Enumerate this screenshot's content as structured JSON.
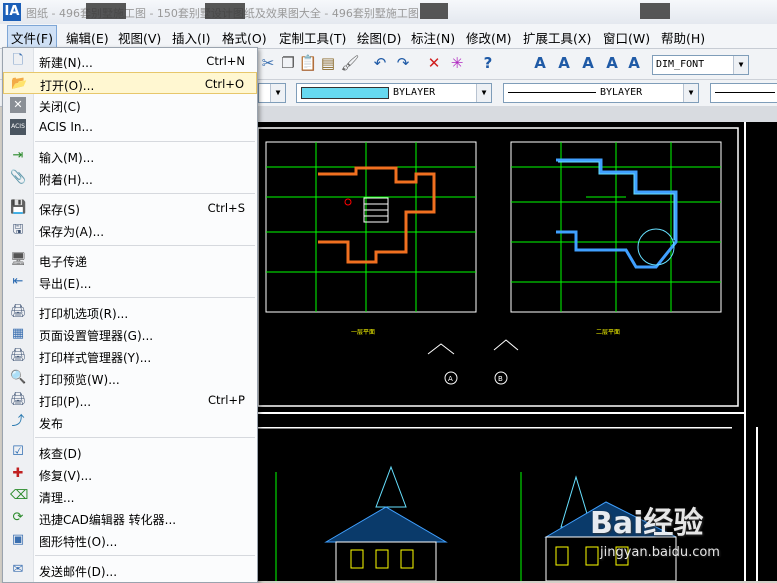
{
  "titlebar": {
    "app_icon": "IA",
    "title": "图纸 - 496套别墅施工图 - 150套别墅设计图纸及效果图大全 - 496套别墅施工图"
  },
  "menubar": {
    "items": [
      {
        "label": "文件(F)"
      },
      {
        "label": "编辑(E)"
      },
      {
        "label": "视图(V)"
      },
      {
        "label": "插入(I)"
      },
      {
        "label": "格式(O)"
      },
      {
        "label": "定制工具(T)"
      },
      {
        "label": "绘图(D)"
      },
      {
        "label": "标注(N)"
      },
      {
        "label": "修改(M)"
      },
      {
        "label": "扩展工具(X)"
      },
      {
        "label": "窗口(W)"
      },
      {
        "label": "帮助(H)"
      }
    ]
  },
  "toolbar": {
    "dim_style": "DIM_FONT",
    "color_layer": "BYLAYER",
    "linetype": "BYLAYER",
    "linecolor": "#66d9f0"
  },
  "file_menu": {
    "items": [
      {
        "label": "新建(N)...",
        "shortcut": "Ctrl+N",
        "icon": "new-file-icon"
      },
      {
        "label": "打开(O)...",
        "shortcut": "Ctrl+O",
        "icon": "open-folder-icon"
      },
      {
        "label": "关闭(C)",
        "shortcut": "",
        "icon": "close-icon"
      },
      {
        "label": "ACIS In...",
        "shortcut": "",
        "icon": "acis-icon"
      },
      {
        "label": "输入(M)...",
        "shortcut": "",
        "icon": "import-icon"
      },
      {
        "label": "附着(H)...",
        "shortcut": "",
        "icon": "attach-icon"
      },
      {
        "label": "保存(S)",
        "shortcut": "Ctrl+S",
        "icon": "save-icon"
      },
      {
        "label": "保存为(A)...",
        "shortcut": "",
        "icon": "save-as-icon"
      },
      {
        "label": "电子传递",
        "shortcut": "",
        "icon": "etransmit-icon"
      },
      {
        "label": "导出(E)...",
        "shortcut": "",
        "icon": "export-icon"
      },
      {
        "label": "打印机选项(R)...",
        "shortcut": "",
        "icon": "printer-options-icon"
      },
      {
        "label": "页面设置管理器(G)...",
        "shortcut": "",
        "icon": "page-setup-icon"
      },
      {
        "label": "打印样式管理器(Y)...",
        "shortcut": "",
        "icon": "plot-style-icon"
      },
      {
        "label": "打印预览(W)...",
        "shortcut": "",
        "icon": "print-preview-icon"
      },
      {
        "label": "打印(P)...",
        "shortcut": "Ctrl+P",
        "icon": "print-icon"
      },
      {
        "label": "发布",
        "shortcut": "",
        "icon": "publish-icon"
      },
      {
        "label": "核查(D)",
        "shortcut": "",
        "icon": "audit-icon"
      },
      {
        "label": "修复(V)...",
        "shortcut": "",
        "icon": "recover-icon"
      },
      {
        "label": "清理...",
        "shortcut": "",
        "icon": "purge-icon"
      },
      {
        "label": "迅捷CAD编辑器 转化器...",
        "shortcut": "",
        "icon": "converter-icon"
      },
      {
        "label": "图形特性(O)...",
        "shortcut": "",
        "icon": "drawing-properties-icon"
      },
      {
        "label": "发送邮件(D)...",
        "shortcut": "",
        "icon": "send-mail-icon"
      }
    ]
  },
  "drawing": {
    "plan_labels": [
      "一层平面",
      "二层平面"
    ],
    "axis_marks": [
      "A",
      "B"
    ]
  },
  "watermark": {
    "brand": "Bai经验",
    "url": "jingyan.baidu.com"
  }
}
